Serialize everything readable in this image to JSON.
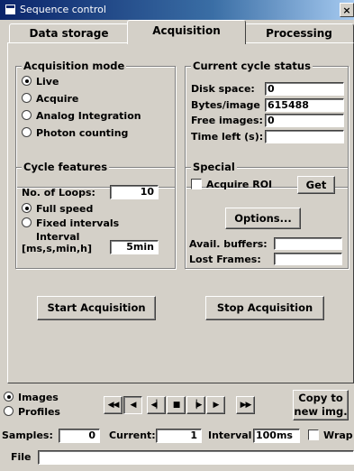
{
  "window": {
    "title": "Sequence control",
    "close_label": "×"
  },
  "tabs": [
    {
      "label": "Data storage"
    },
    {
      "label": "Acquisition"
    },
    {
      "label": "Processing"
    }
  ],
  "acquisition_mode": {
    "title": "Acquisition mode",
    "options": [
      "Live",
      "Acquire",
      "Analog Integration",
      "Photon counting"
    ],
    "selected": "Live"
  },
  "cycle_status": {
    "title": "Current cycle status",
    "disk_space_label": "Disk space:",
    "disk_space_value": "0",
    "bytes_per_image_label": "Bytes/image",
    "bytes_per_image_value": "615488",
    "free_images_label": "Free images:",
    "free_images_value": "0",
    "time_left_label": "Time left (s):",
    "time_left_value": ""
  },
  "cycle_features": {
    "title": "Cycle features",
    "loops_label": "No. of Loops:",
    "loops_value": "10",
    "full_speed_label": "Full speed",
    "fixed_intervals_label": "Fixed intervals",
    "interval_label_1": "Interval",
    "interval_label_2": "[ms,s,min,h]",
    "interval_value": "5min",
    "selected": "Full speed"
  },
  "special": {
    "title": "Special",
    "acquire_roi_label": "Acquire ROI",
    "get_label": "Get",
    "options_label": "Options...",
    "avail_buffers_label": "Avail. buffers:",
    "avail_buffers_value": "",
    "lost_frames_label": "Lost Frames:",
    "lost_frames_value": ""
  },
  "actions": {
    "start_label": "Start Acquisition",
    "stop_label": "Stop Acquisition"
  },
  "view": {
    "images_label": "Images",
    "profiles_label": "Profiles",
    "selected": "Images"
  },
  "playback": {
    "buttons": [
      {
        "name": "first-frame-button",
        "glyph": "◀◀"
      },
      {
        "name": "step-back-button",
        "glyph": "◀"
      },
      {
        "name": "reverse-play-button",
        "glyph": "◀▏"
      },
      {
        "name": "stop-button",
        "glyph": "■"
      },
      {
        "name": "forward-play-button",
        "glyph": "▕▶"
      },
      {
        "name": "step-forward-button",
        "glyph": "▶"
      },
      {
        "name": "last-frame-button",
        "glyph": "▶▶"
      }
    ]
  },
  "copy_button": {
    "line1": "Copy to",
    "line2": "new img."
  },
  "bottom": {
    "samples_label": "Samples:",
    "samples_value": "0",
    "current_label": "Current:",
    "current_value": "1",
    "interval_label": "Interval",
    "interval_value": "100ms",
    "wrap_label": "Wrap",
    "file_label": "File",
    "file_value": ""
  }
}
